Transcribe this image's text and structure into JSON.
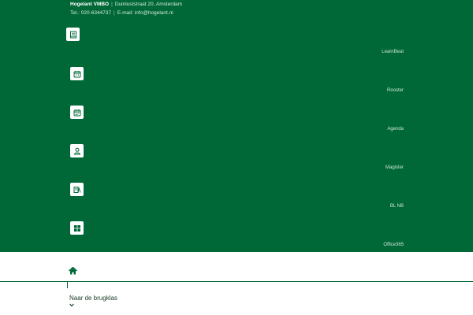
{
  "header": {
    "school_name": "Hogelant VMBO",
    "address": "Duinluststraat 20, Amsterdam",
    "phone": "Tel.: 020-6344737",
    "email": "E-mail: info@hogelant.nl",
    "separator": "|"
  },
  "links": [
    {
      "label": "LearnBeat",
      "icon": "book-icon"
    },
    {
      "label": "Rooster",
      "icon": "calendar-icon"
    },
    {
      "label": "Agenda",
      "icon": "agenda-icon"
    },
    {
      "label": "Magister",
      "icon": "user-icon"
    },
    {
      "label": "BL NB",
      "icon": "document-icon"
    },
    {
      "label": "Office365",
      "icon": "office-icon"
    }
  ],
  "nav": {
    "home_icon": "home-icon",
    "menu_label": "Naar de brugklas",
    "menu_icon": "chevron-down-icon"
  },
  "colors": {
    "brand_green": "#006837",
    "tile_white": "#ffffff"
  }
}
